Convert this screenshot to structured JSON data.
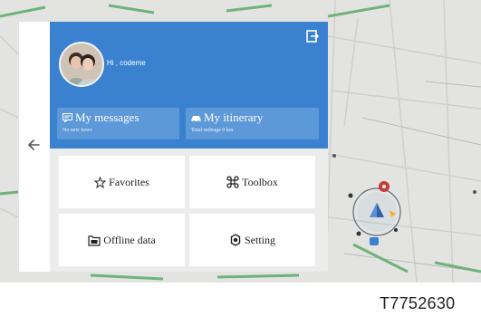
{
  "header": {
    "greeting": "Hi , codeme",
    "cards": [
      {
        "title": "My messages",
        "subtitle": "No new news",
        "icon": "message-icon"
      },
      {
        "title": "My itinerary",
        "subtitle": "Total mileage 0 km",
        "icon": "car-icon"
      }
    ]
  },
  "menu": [
    {
      "label": "Favorites",
      "icon": "star-icon"
    },
    {
      "label": "Toolbox",
      "icon": "command-icon"
    },
    {
      "label": "Offline data",
      "icon": "folder-icon"
    },
    {
      "label": "Setting",
      "icon": "gear-icon"
    }
  ],
  "caption": "T7752630",
  "colors": {
    "header": "#3a82cf",
    "card": "#5d98d8",
    "map": "#e3e4e1",
    "road_green": "#6db37a"
  }
}
